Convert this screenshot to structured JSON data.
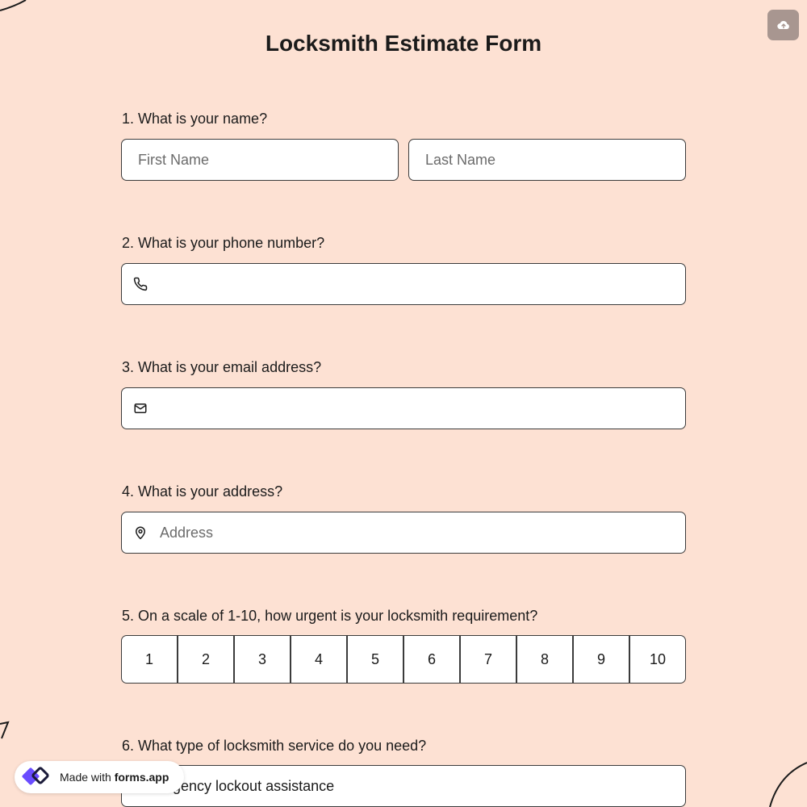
{
  "colors": {
    "background": "#fde1d3",
    "field_bg": "#ffffff",
    "border": "#3b3b3b",
    "upload_button": "#a89690",
    "logo_primary": "#6a4cff",
    "logo_dark": "#1b1b3a"
  },
  "header": {
    "title": "Locksmith Estimate Form",
    "upload_icon": "cloud-upload-icon"
  },
  "questions": {
    "q1": {
      "label": "1.  What is your name?",
      "first_placeholder": "First Name",
      "last_placeholder": "Last Name"
    },
    "q2": {
      "label": "2. What is your phone number?",
      "icon": "phone-icon",
      "value": ""
    },
    "q3": {
      "label": "3. What is your email address?",
      "icon": "mail-icon",
      "value": ""
    },
    "q4": {
      "label": "4. What is your address?",
      "icon": "map-pin-icon",
      "placeholder": "Address"
    },
    "q5": {
      "label": "5. On a scale of 1-10, how urgent is your locksmith requirement?",
      "options": [
        "1",
        "2",
        "3",
        "4",
        "5",
        "6",
        "7",
        "8",
        "9",
        "10"
      ]
    },
    "q6": {
      "label": "6. What type of locksmith service do you need?",
      "selected_value": "Emergency lockout assistance"
    }
  },
  "badge": {
    "made_with": "Made with",
    "brand": "forms.app",
    "logo_icon": "forms-app-logo-icon"
  }
}
